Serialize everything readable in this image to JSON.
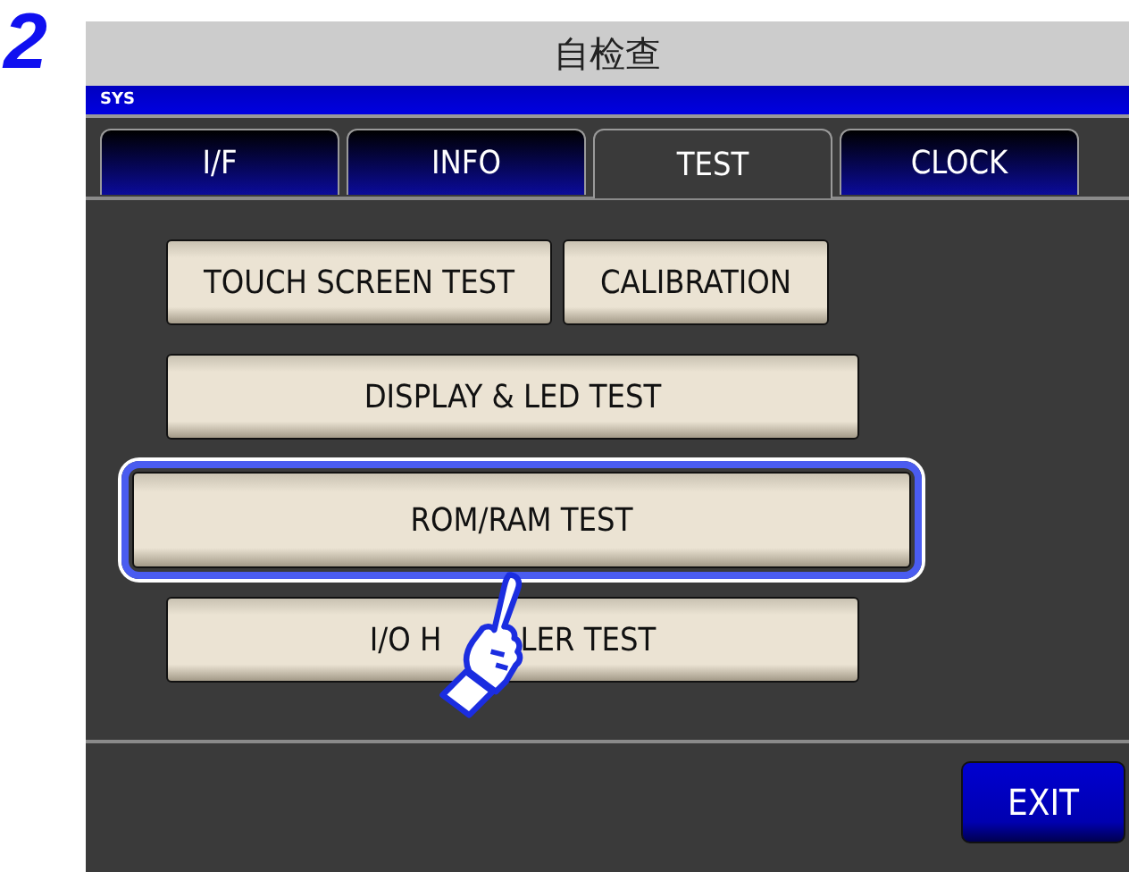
{
  "step": "2",
  "window": {
    "title": "自检查"
  },
  "mode_bar": {
    "label": "SYS"
  },
  "tabs": [
    {
      "label": "I/F",
      "selected": false
    },
    {
      "label": "INFO",
      "selected": false
    },
    {
      "label": "TEST",
      "selected": true
    },
    {
      "label": "CLOCK",
      "selected": false
    }
  ],
  "button_rows": [
    {
      "buttons": [
        {
          "label": "TOUCH SCREEN TEST",
          "selected": false
        },
        {
          "label": "CALIBRATION",
          "selected": false
        }
      ]
    },
    {
      "buttons": [
        {
          "label": "DISPLAY & LED TEST",
          "selected": false
        }
      ]
    },
    {
      "buttons": [
        {
          "label": "ROM/RAM TEST",
          "selected": true
        }
      ]
    },
    {
      "buttons": [
        {
          "label_parts": [
            "I/O H",
            "LER TEST"
          ],
          "selected": false
        }
      ]
    }
  ],
  "exit_button": {
    "label": "EXIT"
  }
}
